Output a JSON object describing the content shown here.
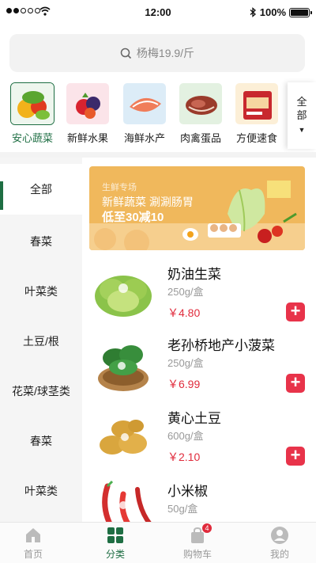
{
  "status_bar": {
    "time": "12:00",
    "battery": "100%"
  },
  "search": {
    "placeholder": "杨梅19.9/斤"
  },
  "categories": [
    {
      "label": "安心蔬菜",
      "icon": "vegetables-image",
      "active": true
    },
    {
      "label": "新鲜水果",
      "icon": "fruit-image",
      "active": false
    },
    {
      "label": "海鲜水产",
      "icon": "seafood-image",
      "active": false
    },
    {
      "label": "肉禽蛋品",
      "icon": "meat-image",
      "active": false
    },
    {
      "label": "方便速食",
      "icon": "instant-food-image",
      "active": false
    }
  ],
  "category_all": {
    "line1": "全",
    "line2": "部"
  },
  "sidebar": {
    "items": [
      {
        "label": "全部",
        "active": true
      },
      {
        "label": "春菜",
        "active": false
      },
      {
        "label": "叶菜类",
        "active": false
      },
      {
        "label": "土豆/根",
        "active": false
      },
      {
        "label": "花菜/球茎类",
        "active": false
      },
      {
        "label": "春菜",
        "active": false
      },
      {
        "label": "叶菜类",
        "active": false
      }
    ]
  },
  "banner": {
    "tag": "生鲜专场",
    "headline": "新鲜蔬菜 涮涮肠胃",
    "promo": "低至30减10"
  },
  "products": [
    {
      "name": "奶油生菜",
      "spec": "250g/盒",
      "price": "￥4.80",
      "icon": "lettuce-image"
    },
    {
      "name": "老孙桥地产小菠菜",
      "spec": "250g/盒",
      "price": "￥6.99",
      "icon": "spinach-image"
    },
    {
      "name": "黄心土豆",
      "spec": "600g/盒",
      "price": "￥2.10",
      "icon": "potato-image"
    },
    {
      "name": "小米椒",
      "spec": "50g/盒",
      "price": "",
      "icon": "chili-image"
    }
  ],
  "tab_bar": {
    "items": [
      {
        "label": "首页",
        "icon": "home-icon",
        "active": false
      },
      {
        "label": "分类",
        "icon": "category-icon",
        "active": true
      },
      {
        "label": "购物车",
        "icon": "cart-icon",
        "active": false,
        "badge": "4"
      },
      {
        "label": "我的",
        "icon": "profile-icon",
        "active": false
      }
    ]
  },
  "colors": {
    "accent": "#1e6e43",
    "price": "#e02b3c",
    "add_button": "#e8334a",
    "banner": "#f0b85c"
  }
}
